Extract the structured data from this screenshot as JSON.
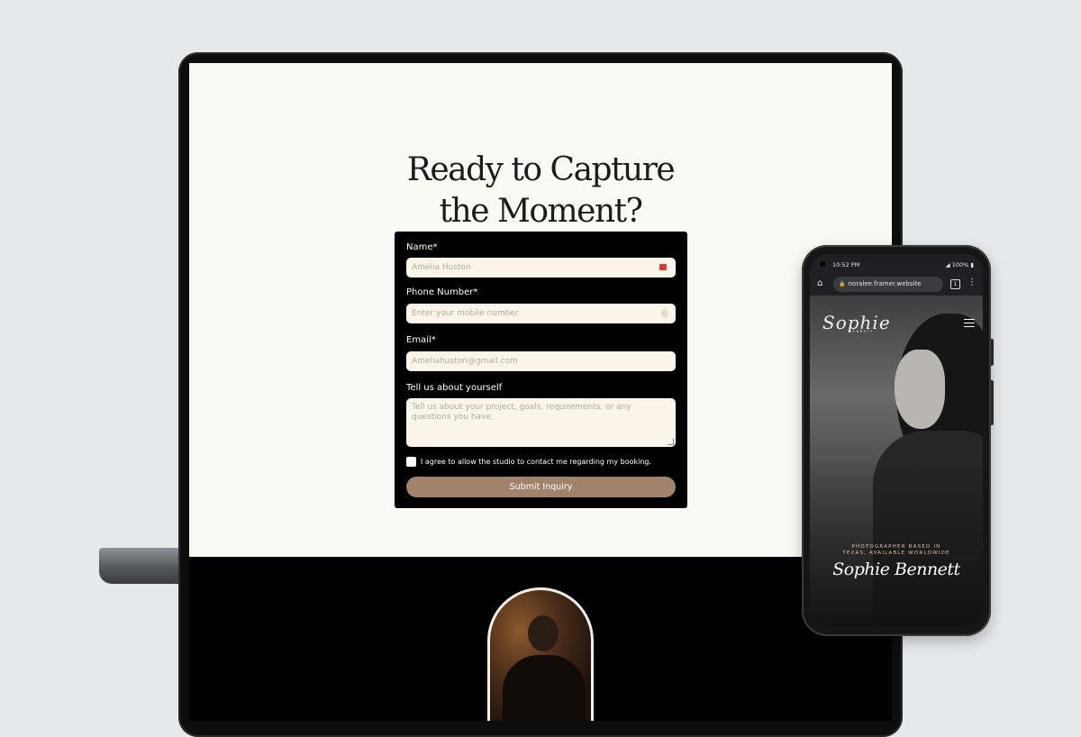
{
  "laptop": {
    "headline_line1": "Ready to Capture",
    "headline_line2": "the Moment?",
    "form": {
      "name_label": "Name*",
      "name_value": "Amelia Huston",
      "phone_label": "Phone Number*",
      "phone_placeholder": "Enter your mobile number",
      "email_label": "Email*",
      "email_value": "Ameliahuston@gmail.com",
      "about_label": "Tell us about yourself",
      "about_placeholder": "Tell us about your project, goals, requirements, or any questions you have.",
      "consent_label": "I agree to allow the studio to contact me regarding my booking.",
      "consent_checked": false,
      "submit_label": "Submit Inquiry"
    }
  },
  "phone": {
    "status_time": "10:52 PM",
    "status_battery": "100%",
    "url": "noralee.framer.website",
    "tab_count": "1",
    "logo_script": "Sophie",
    "logo_sub": "BENNETT",
    "tagline_line1": "PHOTOGRAPHER BASED IN",
    "tagline_line2": "TEXAS, AVAILABLE WORLDWIDE",
    "hero_name": "Sophie Bennett"
  },
  "colors": {
    "page_bg": "#e6e9ec",
    "screen_bg": "#fbf9f3",
    "form_bg": "#000000",
    "input_bg": "#fbf5e9",
    "submit_bg": "#a0836a",
    "tagline": "#d9c3a5"
  }
}
